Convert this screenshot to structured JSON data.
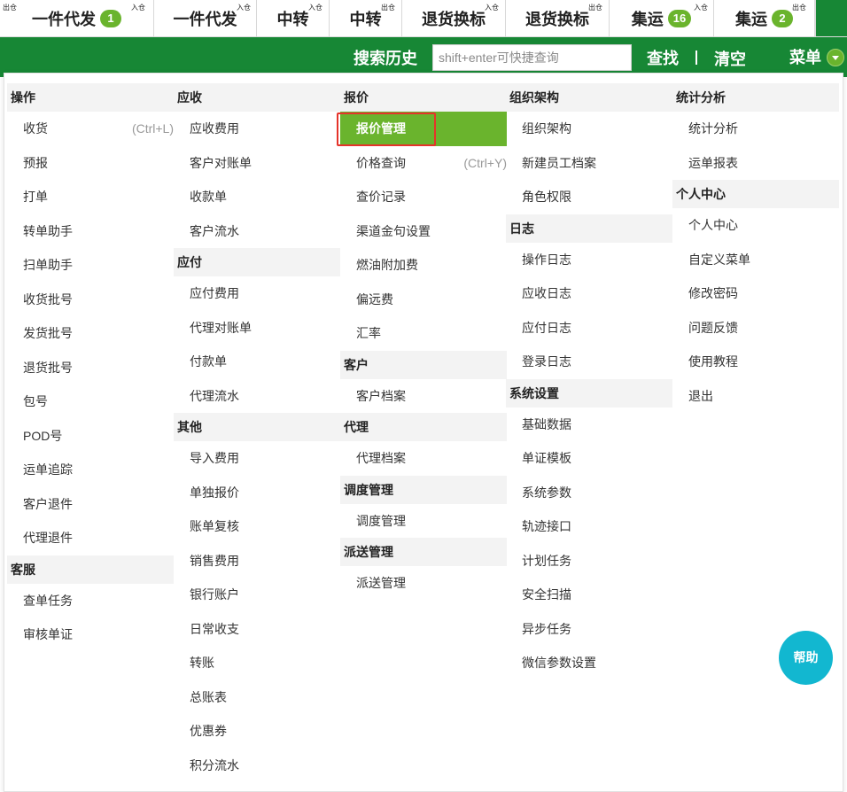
{
  "tabs": [
    {
      "label": "一件代发",
      "tag": "出仓",
      "badge": "1",
      "badge_tag": "入仓"
    },
    {
      "label": "一件代发",
      "tag": "",
      "badge": "",
      "badge_tag": "入仓"
    },
    {
      "label": "中转",
      "tag": "",
      "badge": "",
      "badge_tag": "入仓"
    },
    {
      "label": "中转",
      "tag": "",
      "badge": "",
      "badge_tag": "出仓"
    },
    {
      "label": "退货换标",
      "tag": "",
      "badge": "",
      "badge_tag": "入仓"
    },
    {
      "label": "退货换标",
      "tag": "",
      "badge": "",
      "badge_tag": "出仓"
    },
    {
      "label": "集运",
      "tag": "",
      "badge": "16",
      "badge_tag": "入仓"
    },
    {
      "label": "集运",
      "tag": "",
      "badge": "2",
      "badge_tag": "出仓"
    }
  ],
  "header": {
    "search_history": "搜索历史",
    "search_placeholder": "shift+enter可快捷查询",
    "find": "查找",
    "separator": "|",
    "clear": "清空",
    "menu": "菜单"
  },
  "columns": [
    {
      "sections": [
        {
          "title": "操作",
          "items": [
            {
              "label": "收货",
              "shortcut": "(Ctrl+L)"
            },
            {
              "label": "预报"
            },
            {
              "label": "打单"
            },
            {
              "label": "转单助手"
            },
            {
              "label": "扫单助手"
            },
            {
              "label": "收货批号"
            },
            {
              "label": "发货批号"
            },
            {
              "label": "退货批号"
            },
            {
              "label": "包号"
            },
            {
              "label": "POD号"
            },
            {
              "label": "运单追踪"
            },
            {
              "label": "客户退件"
            },
            {
              "label": "代理退件"
            }
          ]
        },
        {
          "title": "客服",
          "items": [
            {
              "label": "查单任务"
            },
            {
              "label": "审核单证"
            }
          ]
        }
      ]
    },
    {
      "sections": [
        {
          "title": "应收",
          "items": [
            {
              "label": "应收费用"
            },
            {
              "label": "客户对账单"
            },
            {
              "label": "收款单"
            },
            {
              "label": "客户流水"
            }
          ]
        },
        {
          "title": "应付",
          "items": [
            {
              "label": "应付费用"
            },
            {
              "label": "代理对账单"
            },
            {
              "label": "付款单"
            },
            {
              "label": "代理流水"
            }
          ]
        },
        {
          "title": "其他",
          "items": [
            {
              "label": "导入费用"
            },
            {
              "label": "单独报价"
            },
            {
              "label": "账单复核"
            },
            {
              "label": "销售费用"
            },
            {
              "label": "银行账户"
            },
            {
              "label": "日常收支"
            },
            {
              "label": "转账"
            },
            {
              "label": "总账表"
            },
            {
              "label": "优惠券"
            },
            {
              "label": "积分流水"
            }
          ]
        }
      ]
    },
    {
      "sections": [
        {
          "title": "报价",
          "items": [
            {
              "label": "报价管理",
              "active": true
            },
            {
              "label": "价格查询",
              "shortcut": "(Ctrl+Y)"
            },
            {
              "label": "查价记录"
            },
            {
              "label": "渠道金句设置"
            },
            {
              "label": "燃油附加费"
            },
            {
              "label": "偏远费"
            },
            {
              "label": "汇率"
            }
          ]
        },
        {
          "title": "客户",
          "items": [
            {
              "label": "客户档案"
            }
          ]
        },
        {
          "title": "代理",
          "items": [
            {
              "label": "代理档案"
            }
          ]
        },
        {
          "title": "调度管理",
          "items": [
            {
              "label": "调度管理"
            }
          ]
        },
        {
          "title": "派送管理",
          "items": [
            {
              "label": "派送管理"
            }
          ]
        }
      ]
    },
    {
      "sections": [
        {
          "title": "组织架构",
          "items": [
            {
              "label": "组织架构"
            },
            {
              "label": "新建员工档案"
            },
            {
              "label": "角色权限"
            }
          ]
        },
        {
          "title": "日志",
          "items": [
            {
              "label": "操作日志"
            },
            {
              "label": "应收日志"
            },
            {
              "label": "应付日志"
            },
            {
              "label": "登录日志"
            }
          ]
        },
        {
          "title": "系统设置",
          "items": [
            {
              "label": "基础数据"
            },
            {
              "label": "单证模板"
            },
            {
              "label": "系统参数"
            },
            {
              "label": "轨迹接口"
            },
            {
              "label": "计划任务"
            },
            {
              "label": "安全扫描"
            },
            {
              "label": "异步任务"
            },
            {
              "label": "微信参数设置"
            }
          ]
        }
      ]
    },
    {
      "sections": [
        {
          "title": "统计分析",
          "items": [
            {
              "label": "统计分析"
            },
            {
              "label": "运单报表"
            }
          ]
        },
        {
          "title": "个人中心",
          "items": [
            {
              "label": "个人中心"
            },
            {
              "label": "自定义菜单"
            },
            {
              "label": "修改密码"
            },
            {
              "label": "问题反馈"
            },
            {
              "label": "使用教程"
            },
            {
              "label": "退出"
            }
          ]
        }
      ]
    }
  ],
  "help": {
    "label": "帮助"
  },
  "colors": {
    "header_green": "#178735",
    "accent_green": "#6ab42d",
    "highlight_red": "#e5332a",
    "help_cyan": "#12b7d0"
  }
}
